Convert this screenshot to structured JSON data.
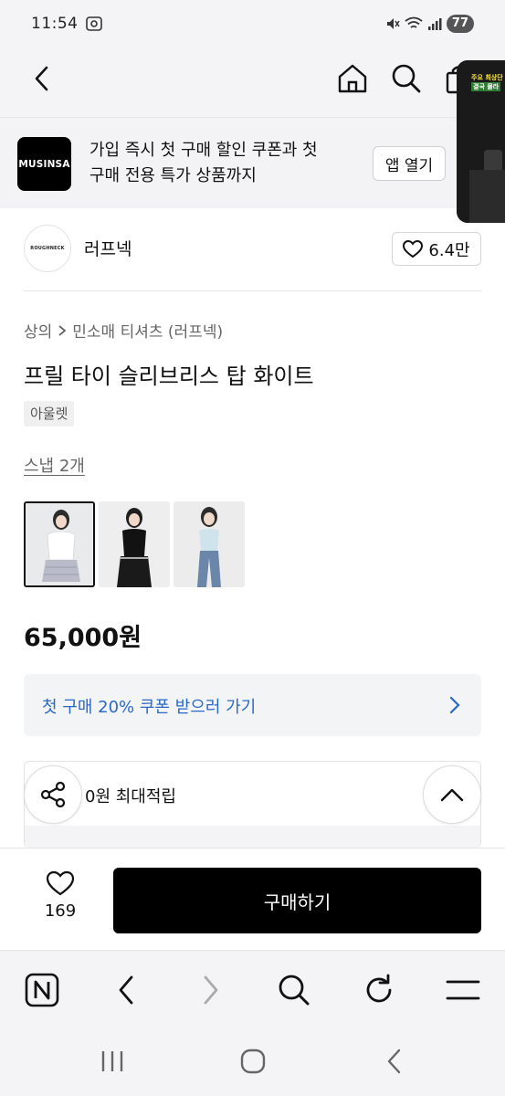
{
  "status_bar": {
    "time": "11:54",
    "battery": "77"
  },
  "header": {
    "icons": [
      "back-icon",
      "home-icon",
      "search-icon",
      "bag-icon"
    ]
  },
  "banner": {
    "logo_text": "MUSINSA",
    "line1": "가입 즉시 첫 구매 할인 쿠폰과 첫",
    "line2": "구매 전용 특가 상품까지",
    "button_label": "앱 열기"
  },
  "pip": {
    "tag1": "주요 최상단",
    "tag2": "결국 몰라"
  },
  "brand": {
    "logo_text": "ROUGHNECK",
    "name": "러프넥",
    "likes": "6.4만"
  },
  "breadcrumb": {
    "category": "상의",
    "subcategory": "민소매 티셔츠 (러프넥)"
  },
  "product": {
    "title": "프릴 타이 슬리브리스 탑 화이트",
    "badge": "아울렛",
    "snap_link": "스냅 2개",
    "price": "65,000원"
  },
  "coupon": {
    "label": "첫 구매 20% 쿠폰 받으러 가기"
  },
  "points": {
    "text": "0원 최대적립"
  },
  "bottom_bar": {
    "wish_count": "169",
    "buy_label": "구매하기"
  },
  "colors": {
    "accent_blue": "#2a68c8",
    "primary_black": "#000000",
    "bg_gray": "#f4f4f6"
  }
}
